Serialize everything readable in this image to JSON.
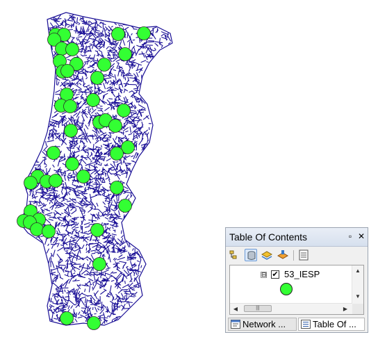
{
  "map": {
    "network_color": "#1a0f96",
    "point_color": "#33ff33",
    "point_outline": "#2a2a2a"
  },
  "toc": {
    "title": "Table Of Contents",
    "pin_icon": "▫",
    "close_icon": "✕",
    "toolbar": [
      "list-by-drawing-order-icon",
      "list-by-source-icon",
      "list-by-visibility-icon",
      "list-by-selection-icon",
      "options-icon"
    ],
    "layer": {
      "name": "53_IESP",
      "checked": true,
      "expander": "⊟",
      "check_mark": "✔",
      "symbol_color": "#33ff33"
    },
    "scroll": {
      "up": "▲",
      "down": "▼",
      "left": "◀",
      "right": "▶",
      "grip": "|||"
    },
    "tabs": [
      {
        "label": "Network ...",
        "icon": "network-dataset-icon",
        "active": false
      },
      {
        "label": "Table Of ...",
        "icon": "table-of-contents-icon",
        "active": true
      }
    ]
  }
}
